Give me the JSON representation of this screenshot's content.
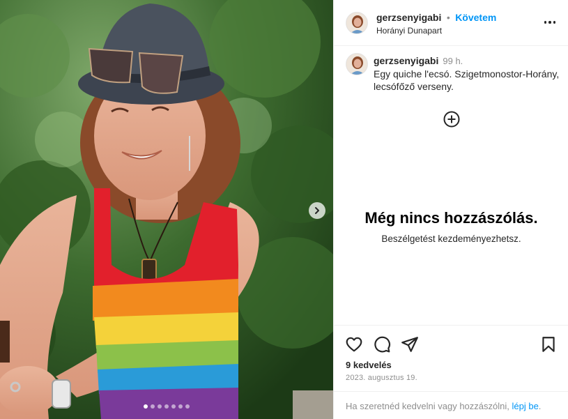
{
  "post": {
    "username": "gerzsenyigabi",
    "follow_label": "Követem",
    "separator": "•",
    "location": "Horányi Dunapart"
  },
  "caption": {
    "username": "gerzsenyigabi",
    "time": "99 h.",
    "text": "Egy quiche l'ecsó. Szigetmonostor-Horány, lecsófőző verseny."
  },
  "comments": {
    "empty_title": "Még nincs hozzászólás.",
    "empty_subtitle": "Beszélgetést kezdeményezhetsz."
  },
  "stats": {
    "likes": "9 kedvelés",
    "date": "2023. augusztus 19."
  },
  "login_prompt": {
    "text": "Ha szeretnéd kedvelni vagy hozzászólni,",
    "link": "lépj be",
    "suffix": "."
  },
  "carousel": {
    "slide_count": 7,
    "active_index": 0
  },
  "icons": {
    "like": "heart-icon",
    "comment": "comment-icon",
    "share": "share-icon",
    "save": "bookmark-icon",
    "add_comment": "plus-circle-icon",
    "more": "more-options-icon",
    "next": "chevron-right-icon"
  },
  "colors": {
    "link": "#0095f6",
    "text": "#262626",
    "muted": "#8e8e8e",
    "divider": "#efefef"
  }
}
